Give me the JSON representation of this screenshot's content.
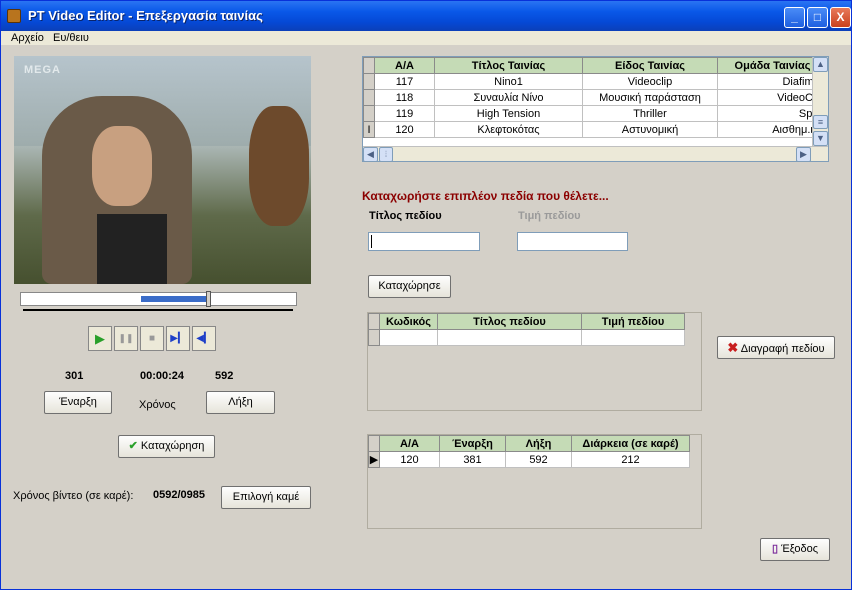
{
  "window": {
    "title": "PT Video Editor - Επεξεργασία ταινίας",
    "min": "_",
    "max": "□",
    "close": "X"
  },
  "menu": [
    "Αρχείο",
    "Ευ/θειυ"
  ],
  "video": {
    "logo": "MEGA"
  },
  "seek": {
    "position_fraction": 0.68
  },
  "controls": {
    "play": "▶",
    "pause": "❚❚",
    "stop": "■",
    "next": "▶▎",
    "prev": "◀▎"
  },
  "timing": {
    "start_frame": "301",
    "time": "00:00:24",
    "end_frame": "592"
  },
  "buttons": {
    "start": "Έναρξη",
    "time_label": "Χρόνος",
    "end": "Λήξη",
    "save": "Καταχώρηση",
    "select_camera": "Επιλογή καμέ",
    "register": "Καταχώρησε",
    "delete_field": "Διαγραφή πεδίου",
    "exit": "Έξοδος"
  },
  "video_time": {
    "label": "Χρόνος βίντεο (σε καρέ):",
    "value": "0592/0985"
  },
  "movies_table": {
    "columns": [
      "Α/Α",
      "Τίτλος Ταινίας",
      "Είδος Ταινίας",
      "Ομάδα Ταινίας"
    ],
    "rows": [
      [
        "117",
        "Nino1",
        "Videoclip",
        "Diafimisi"
      ],
      [
        "118",
        "Συναυλία Νίνο",
        "Μουσική παράσταση",
        "VideoClip"
      ],
      [
        "119",
        "High Tension",
        "Thriller",
        "Splat"
      ],
      [
        "120",
        "Κλεφτοκότας",
        "Αστυνομική",
        "Αισθημ.ιστ"
      ]
    ]
  },
  "extra_fields": {
    "heading": "Καταχωρήστε επιπλέον πεδία που θέλετε...",
    "title_label": "Τίτλος πεδίου",
    "value_label": "Τιμή πεδίου"
  },
  "fields_table": {
    "columns": [
      "Κωδικός",
      "Τίτλος πεδίου",
      "Τιμή πεδίου"
    ]
  },
  "segments_table": {
    "columns": [
      "Α/Α",
      "Έναρξη",
      "Λήξη",
      "Διάρκεια (σε καρέ)"
    ],
    "rows": [
      [
        "120",
        "381",
        "592",
        "212"
      ]
    ]
  },
  "colors": {
    "title_bar": "#0a58e8",
    "heading": "#8b0000",
    "grid_header": "#c5dbb6",
    "seek_fill": "#3a6cc8"
  }
}
